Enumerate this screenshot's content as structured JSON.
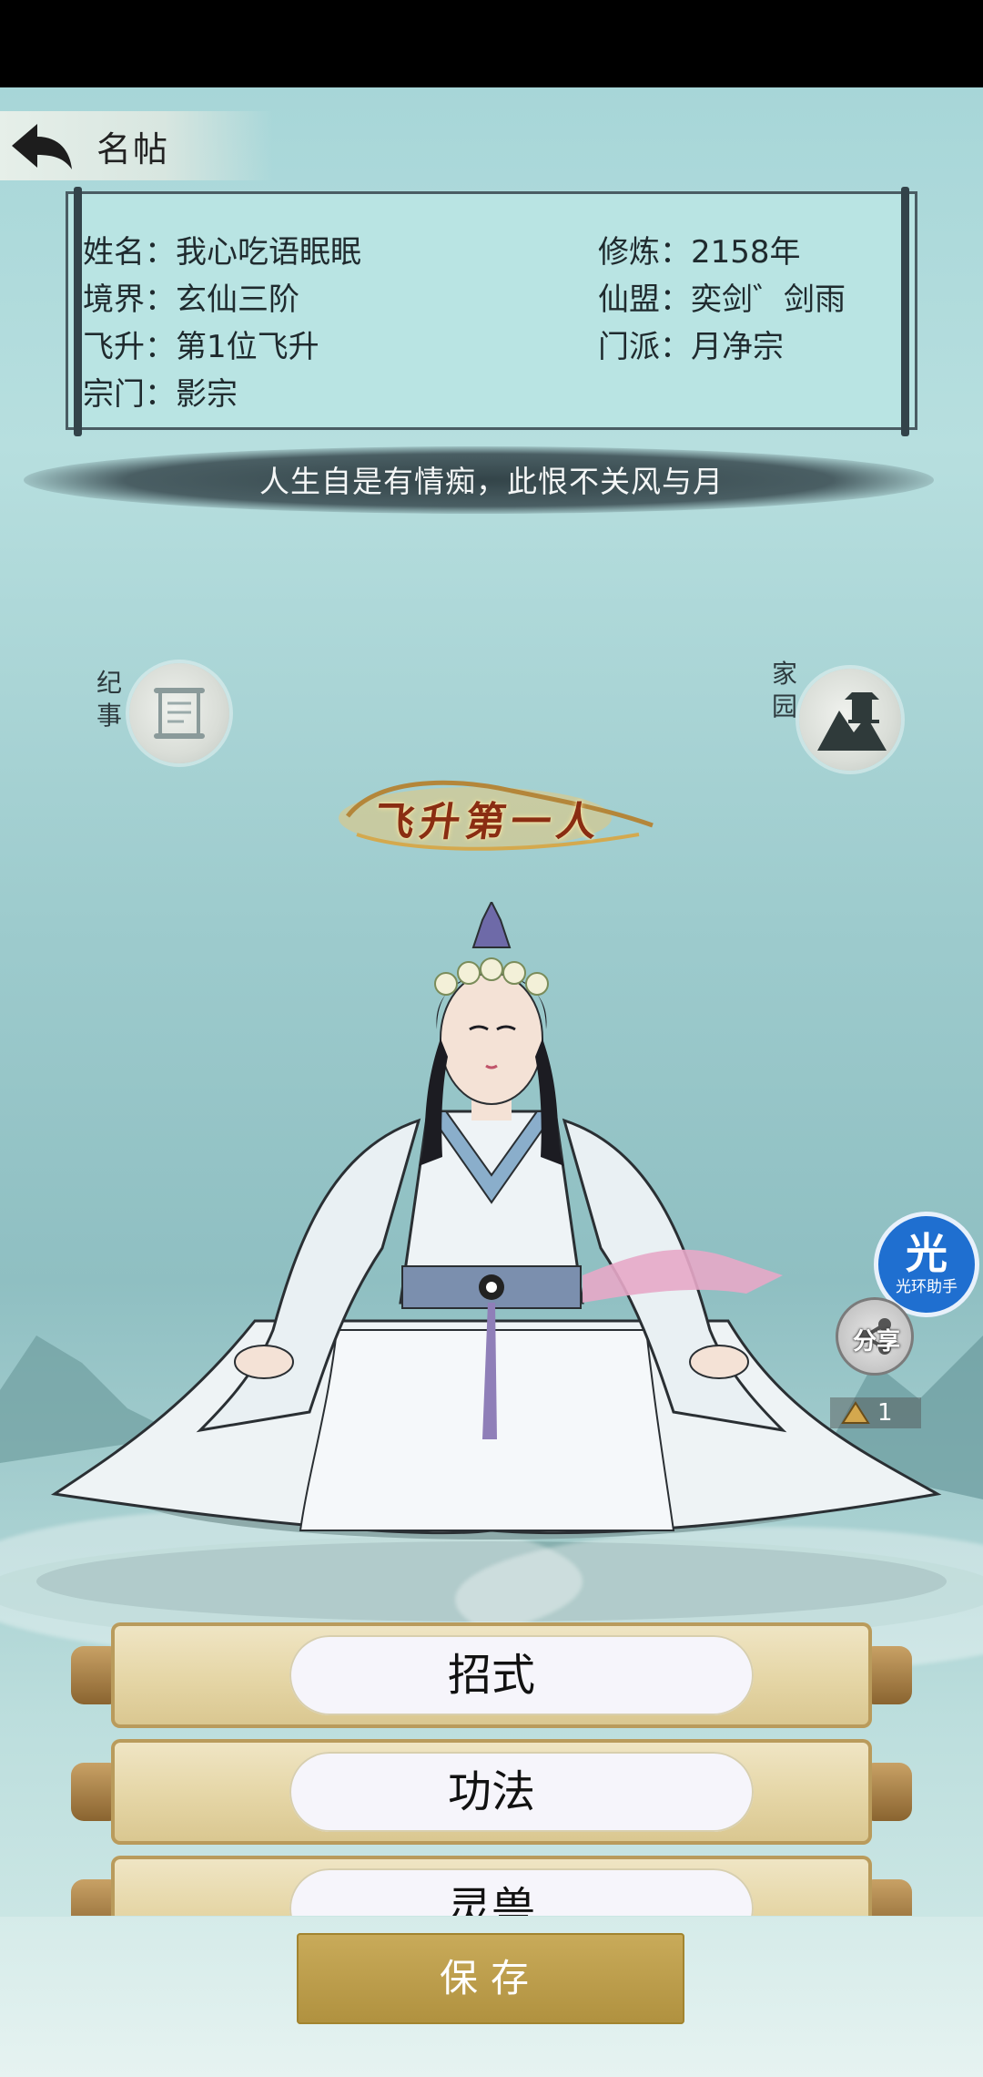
{
  "header": {
    "title": "名帖"
  },
  "profile": {
    "name_label": "姓名：我心吃语眠眠",
    "realm_label": "境界：玄仙三阶",
    "ascension_label": "飞升：第1位飞升",
    "clan_label": "宗门：影宗",
    "cultivation_label": "修炼：2158年",
    "alliance_label": "仙盟：奕剑゛剑雨",
    "sect_label": "门派：月净宗"
  },
  "motto": "人生自是有情痴，此恨不关风与月",
  "side_buttons": {
    "chronicle": "纪事",
    "homestead": "家园"
  },
  "title_badge": "飞升第一人",
  "floating": {
    "assistant_big": "光",
    "assistant_small": "光环助手",
    "share_label": "分享",
    "share_count": "1"
  },
  "tabs": [
    "招式",
    "功法",
    "灵兽"
  ],
  "save_label": "保存",
  "colors": {
    "scene_teal": "#a7d6d8",
    "card_bg": "#b9e4e3",
    "save_gold": "#c9ab5a",
    "assistant_blue": "#1f6fd0"
  }
}
